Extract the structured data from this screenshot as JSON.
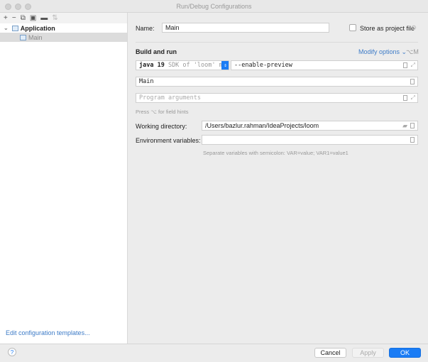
{
  "window": {
    "title": "Run/Debug Configurations"
  },
  "sidebar": {
    "toolbar": [
      {
        "icon": "plus-icon",
        "glyph": "+"
      },
      {
        "icon": "minus-icon",
        "glyph": "−"
      },
      {
        "icon": "copy-icon",
        "glyph": "⧉"
      },
      {
        "icon": "save-icon",
        "glyph": "▣"
      },
      {
        "icon": "folder-add-icon",
        "glyph": "▬"
      },
      {
        "icon": "sort-icon",
        "glyph": "⇅"
      }
    ],
    "tree": {
      "group": "Application",
      "item": "Main"
    },
    "edit_templates": "Edit configuration templates..."
  },
  "form": {
    "name_label": "Name:",
    "name_value": "Main",
    "store_label": "Store as project file",
    "section": "Build and run",
    "modify_options": "Modify options",
    "modify_shortcut": "⌥M",
    "jdk_bold": "java 19",
    "jdk_rest": " SDK of 'loom' mo",
    "vm_options": "--enable-preview",
    "main_class": "Main",
    "program_args_placeholder": "Program arguments",
    "field_hint": "Press ⌥ for field hints",
    "workdir_label": "Working directory:",
    "workdir_value": "/Users/bazlur.rahman/IdeaProjects/loom",
    "env_label": "Environment variables:",
    "env_value": "",
    "env_hint": "Separate variables with semicolon: VAR=value; VAR1=value1"
  },
  "footer": {
    "help": "?",
    "cancel": "Cancel",
    "apply": "Apply",
    "ok": "OK"
  },
  "colors": {
    "accent": "#1a7cf5",
    "link": "#3d7bc7"
  }
}
